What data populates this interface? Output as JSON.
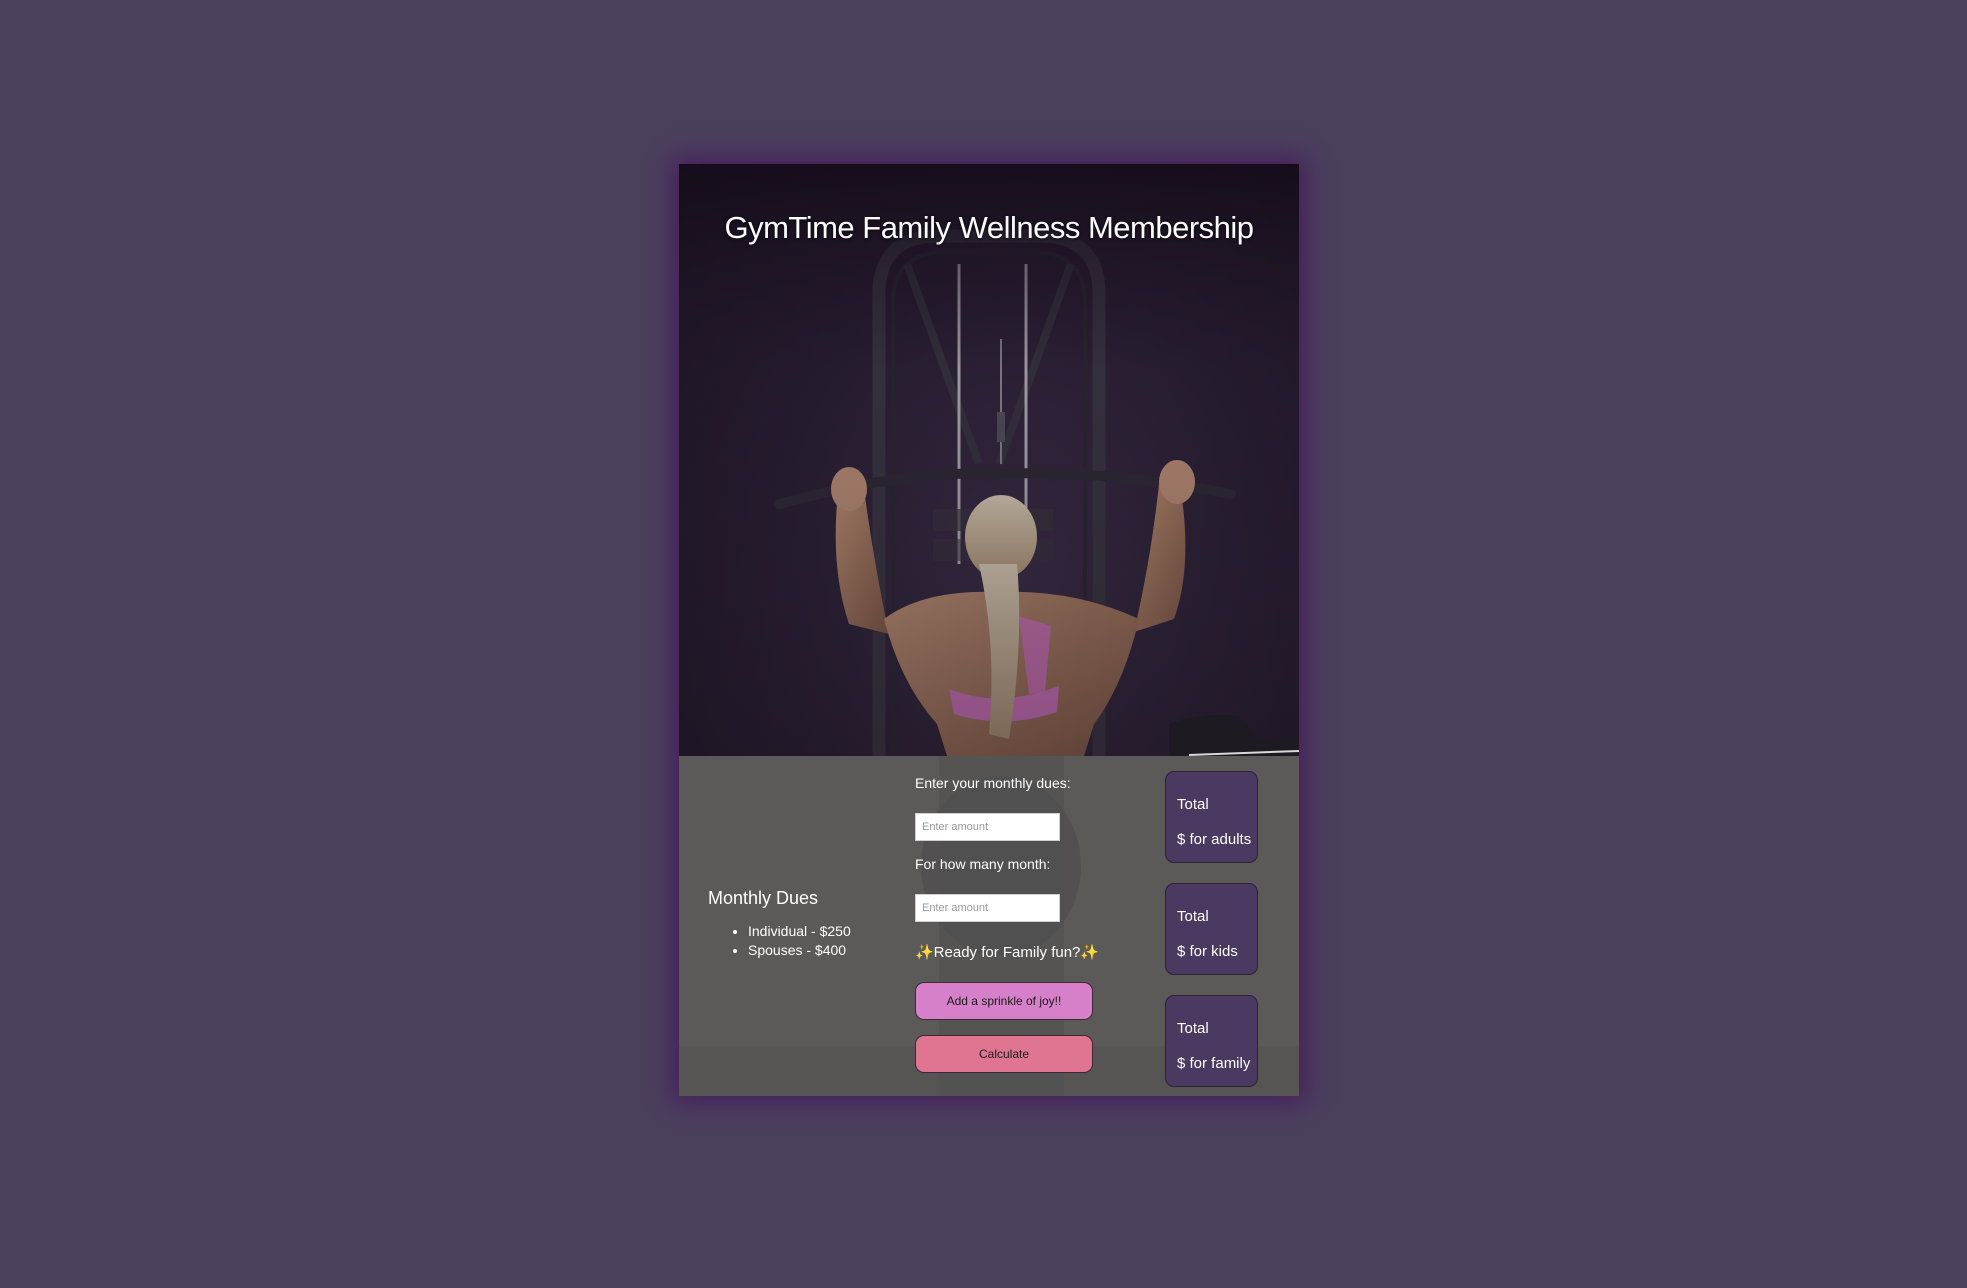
{
  "page": {
    "title": "GymTime Family Wellness Membership",
    "colors": {
      "background": "#4b3f5e",
      "panel": "#5b5a58",
      "total_box": "#4a3960",
      "joy_button": "#d580c8",
      "calculate_button": "#df7591"
    }
  },
  "dues": {
    "heading": "Monthly Dues",
    "items": [
      "Individual - $250",
      "Spouses - $400"
    ]
  },
  "form": {
    "dues_label": "Enter your monthly dues:",
    "dues_placeholder": "Enter amount",
    "dues_value": "",
    "months_label": "For how many month:",
    "months_placeholder": "Enter amount",
    "months_value": "",
    "ready_text": "✨Ready for Family fun?✨",
    "joy_button": "Add a sprinkle of joy!!",
    "calculate_button": "Calculate"
  },
  "totals": [
    {
      "label": "Total",
      "suffix": "$ for adults"
    },
    {
      "label": "Total",
      "suffix": "$ for kids"
    },
    {
      "label": "Total",
      "suffix": "$ for family"
    }
  ]
}
